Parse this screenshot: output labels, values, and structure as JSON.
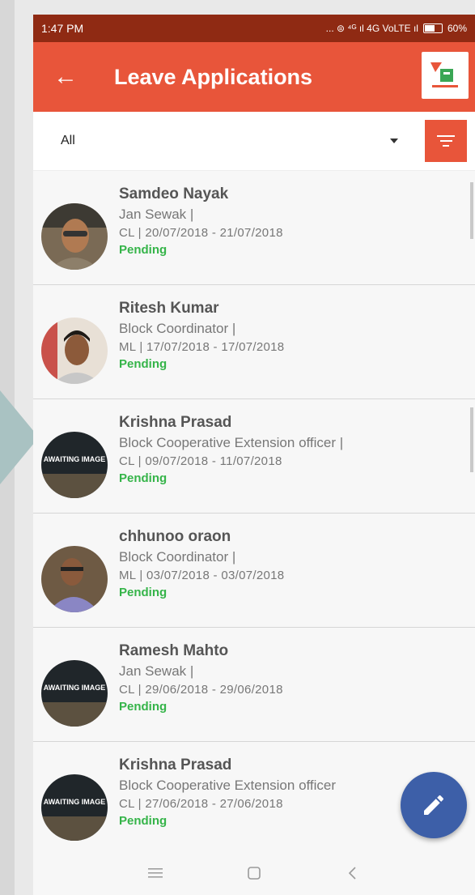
{
  "status_bar": {
    "time": "1:47 PM",
    "indicators": "... ⊜ ⁴ᴳ ıl 4G VoLTE ıl",
    "battery": "60%"
  },
  "app_bar": {
    "title": "Leave Applications",
    "back_icon": "arrow-left-icon",
    "logo_text": "app-logo"
  },
  "filter": {
    "selected": "All",
    "filter_icon": "filter-icon"
  },
  "items": [
    {
      "name": "Samdeo  Nayak",
      "designation": "Jan Sewak |",
      "dates": "CL | 20/07/2018 - 21/07/2018",
      "status": "Pending",
      "avatar": "photo"
    },
    {
      "name": "Ritesh Kumar",
      "designation": "Block Coordinator |",
      "dates": "ML | 17/07/2018 - 17/07/2018",
      "status": "Pending",
      "avatar": "photo"
    },
    {
      "name": "Krishna Prasad",
      "designation": "Block Cooperative Extension officer |",
      "dates": "CL | 09/07/2018 - 11/07/2018",
      "status": "Pending",
      "avatar": "AWAITING IMAGE"
    },
    {
      "name": "chhunoo oraon",
      "designation": "Block Coordinator |",
      "dates": "ML | 03/07/2018 - 03/07/2018",
      "status": "Pending",
      "avatar": "photo"
    },
    {
      "name": "Ramesh Mahto",
      "designation": "Jan Sewak |",
      "dates": "CL | 29/06/2018 - 29/06/2018",
      "status": "Pending",
      "avatar": "AWAITING IMAGE"
    },
    {
      "name": "Krishna Prasad",
      "designation": "Block Cooperative Extension officer",
      "dates": "CL | 27/06/2018 - 27/06/2018",
      "status": "Pending",
      "avatar": "AWAITING IMAGE"
    }
  ],
  "fab": {
    "icon": "edit-pencil-icon"
  },
  "colors": {
    "primary": "#e8553a",
    "status_bar": "#8f2a13",
    "pending": "#35b449",
    "fab": "#3d5fa8"
  }
}
